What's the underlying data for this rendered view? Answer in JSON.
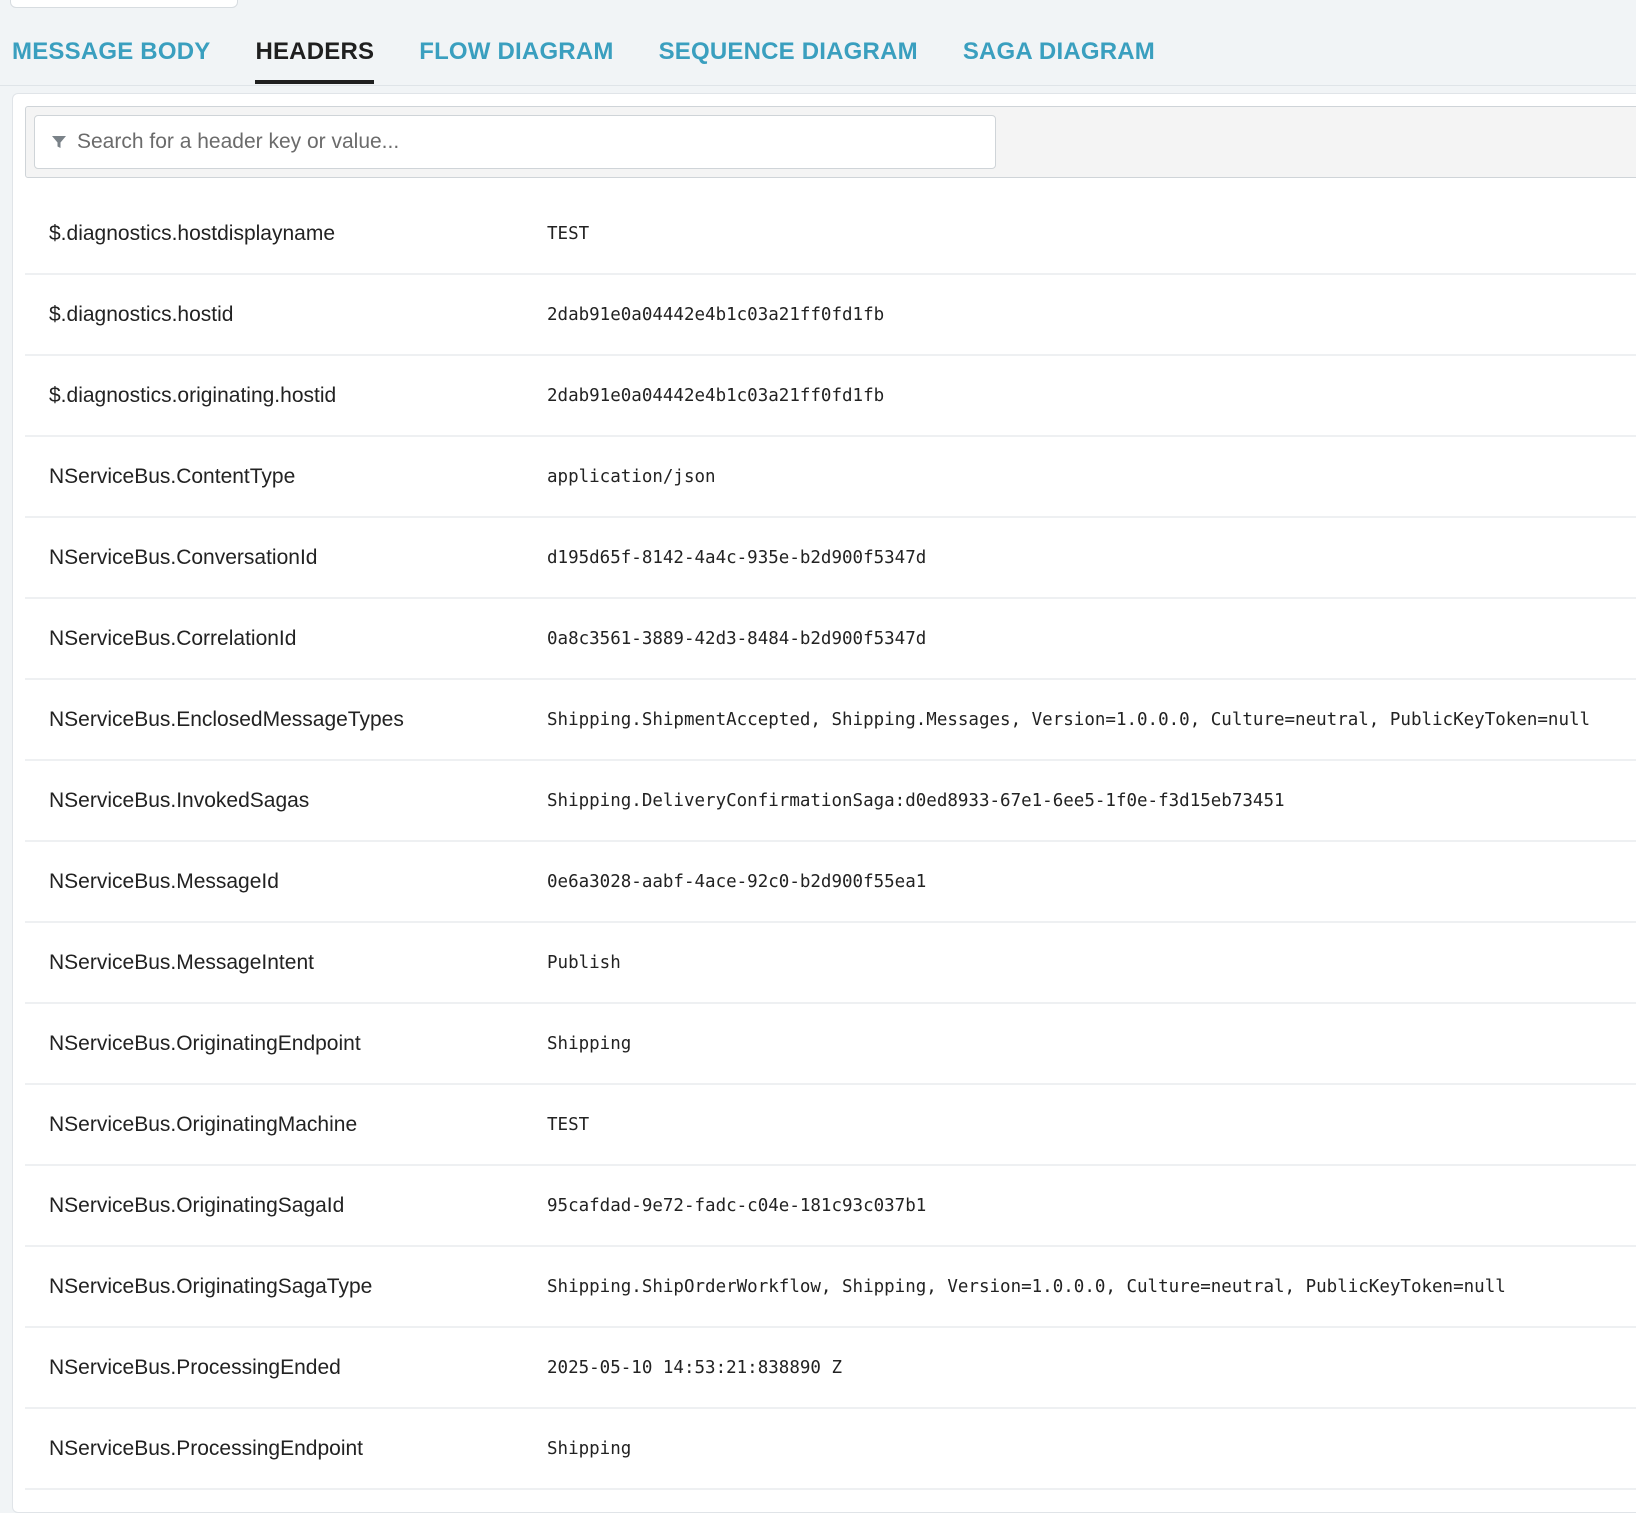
{
  "tabs": [
    {
      "label": "MESSAGE BODY",
      "active": false
    },
    {
      "label": "HEADERS",
      "active": true
    },
    {
      "label": "FLOW DIAGRAM",
      "active": false
    },
    {
      "label": "SEQUENCE DIAGRAM",
      "active": false
    },
    {
      "label": "SAGA DIAGRAM",
      "active": false
    }
  ],
  "search": {
    "placeholder": "Search for a header key or value...",
    "value": "",
    "icon": "filter-icon"
  },
  "headers": [
    {
      "key": "$.diagnostics.hostdisplayname",
      "value": "TEST"
    },
    {
      "key": "$.diagnostics.hostid",
      "value": "2dab91e0a04442e4b1c03a21ff0fd1fb"
    },
    {
      "key": "$.diagnostics.originating.hostid",
      "value": "2dab91e0a04442e4b1c03a21ff0fd1fb"
    },
    {
      "key": "NServiceBus.ContentType",
      "value": "application/json"
    },
    {
      "key": "NServiceBus.ConversationId",
      "value": "d195d65f-8142-4a4c-935e-b2d900f5347d"
    },
    {
      "key": "NServiceBus.CorrelationId",
      "value": "0a8c3561-3889-42d3-8484-b2d900f5347d"
    },
    {
      "key": "NServiceBus.EnclosedMessageTypes",
      "value": "Shipping.ShipmentAccepted, Shipping.Messages, Version=1.0.0.0, Culture=neutral, PublicKeyToken=null"
    },
    {
      "key": "NServiceBus.InvokedSagas",
      "value": "Shipping.DeliveryConfirmationSaga:d0ed8933-67e1-6ee5-1f0e-f3d15eb73451"
    },
    {
      "key": "NServiceBus.MessageId",
      "value": "0e6a3028-aabf-4ace-92c0-b2d900f55ea1"
    },
    {
      "key": "NServiceBus.MessageIntent",
      "value": "Publish"
    },
    {
      "key": "NServiceBus.OriginatingEndpoint",
      "value": "Shipping"
    },
    {
      "key": "NServiceBus.OriginatingMachine",
      "value": "TEST"
    },
    {
      "key": "NServiceBus.OriginatingSagaId",
      "value": "95cafdad-9e72-fadc-c04e-181c93c037b1"
    },
    {
      "key": "NServiceBus.OriginatingSagaType",
      "value": "Shipping.ShipOrderWorkflow, Shipping, Version=1.0.0.0, Culture=neutral, PublicKeyToken=null"
    },
    {
      "key": "NServiceBus.ProcessingEnded",
      "value": "2025-05-10 14:53:21:838890 Z"
    },
    {
      "key": "NServiceBus.ProcessingEndpoint",
      "value": "Shipping"
    }
  ],
  "colors": {
    "tab_link": "#3a9fbf",
    "tab_active": "#1f1f1f",
    "page_bg": "#f1f4f6"
  }
}
